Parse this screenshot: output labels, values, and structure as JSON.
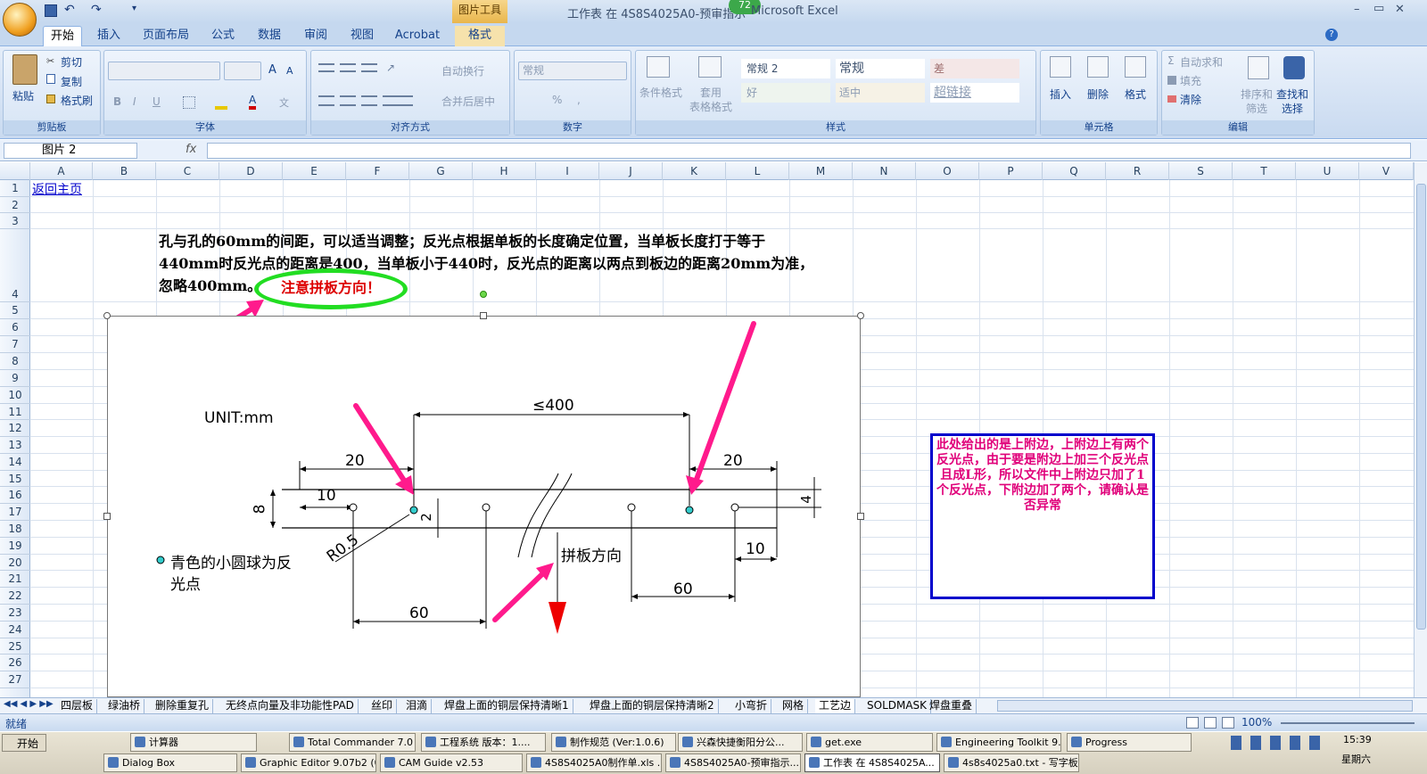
{
  "window": {
    "title": "工作表 在 4S8S4025A0-预审指示",
    "title_suffix": "Microsoft Excel",
    "picture_tools": "图片工具",
    "picture_tools_tab": "格式",
    "badge": "72",
    "min": "–",
    "max": "▭",
    "close": "✕"
  },
  "ribbon_tabs": [
    "开始",
    "插入",
    "页面布局",
    "公式",
    "数据",
    "审阅",
    "视图",
    "Acrobat"
  ],
  "ribbon": {
    "clipboard": {
      "paste": "粘贴",
      "cut": "剪切",
      "copy": "复制",
      "format_painter": "格式刷",
      "label": "剪贴板"
    },
    "font": {
      "label": "字体",
      "grow": "A",
      "shrink": "A",
      "bold": "B",
      "italic": "I",
      "underline": "U",
      "color_letter": "A"
    },
    "alignment": {
      "wrap": "自动换行",
      "merge": "合并后居中",
      "label": "对齐方式"
    },
    "number": {
      "format": "常规",
      "percent": "%",
      "comma": ",",
      "label": "数字"
    },
    "styles": {
      "conditional": "条件格式",
      "table_format_line1": "套用",
      "table_format_line2": "表格格式",
      "normal2": "常规 2",
      "normal": "常规",
      "bad": "差",
      "good": "好",
      "neutral": "适中",
      "hyperlink": "超链接",
      "label": "样式"
    },
    "cells": {
      "insert": "插入",
      "delete": "删除",
      "format": "格式",
      "label": "单元格"
    },
    "editing": {
      "autosum": "自动求和",
      "fill": "填充",
      "clear": "清除",
      "sort_line1": "排序和",
      "sort_line2": "筛选",
      "find_line1": "查找和",
      "find_line2": "选择",
      "label": "编辑"
    }
  },
  "formula_bar": {
    "name_box": "图片 2",
    "fx": "fx",
    "value": ""
  },
  "columns": [
    "A",
    "B",
    "C",
    "D",
    "E",
    "F",
    "G",
    "H",
    "I",
    "J",
    "K",
    "L",
    "M",
    "N",
    "O",
    "P",
    "Q",
    "R",
    "S",
    "T",
    "U",
    "V"
  ],
  "rows": [
    "1",
    "2",
    "3",
    "4",
    "5",
    "6",
    "7",
    "8",
    "9",
    "10",
    "11",
    "12",
    "13",
    "14",
    "15",
    "16",
    "17",
    "18",
    "19",
    "20",
    "21",
    "22",
    "23",
    "24",
    "25",
    "26",
    "27"
  ],
  "cells": {
    "a1_link": "返回主页",
    "note_line1": "孔与孔的60mm的间距，可以适当调整；反光点根据单板的长度确定位置，当单板长度打于等于",
    "note_line2": "440mm时反光点的距离是400，当单板小于440时，反光点的距离以两点到板边的距离20mm为准，",
    "note_line3": "忽略400mm。",
    "callout": "注意拼板方向！",
    "bluebox_text": "此处给出的是上附边，上附边上有两个反光点，由于要是附边上加三个反光点且成L形，所以文件中上附边只加了1个反光点，下附边加了两个，请确认是否异常"
  },
  "drawing": {
    "unit": "UNIT:mm",
    "dim_le400": "≤400",
    "dim_20_left": "20",
    "dim_20_right": "20",
    "dim_10_left": "10",
    "dim_10_right": "10",
    "dim_8": "8",
    "dim_2": "2",
    "dim_4": "4",
    "dim_r05": "R0.5",
    "dim_60_left": "60",
    "dim_60_right": "60",
    "panel_dir": "拼板方向",
    "legend_line1": "青色的小圆球为反",
    "legend_line2": "光点"
  },
  "sheet_tabs": [
    "四层板",
    "绿油桥",
    "删除重复孔",
    "无终点向量及非功能性PAD",
    "丝印",
    "泪滴",
    "焊盘上面的铜层保持清晰1",
    "焊盘上面的铜层保持清晰2",
    "小弯折",
    "网格",
    "工艺边",
    "SOLDMASK",
    "焊盘重叠"
  ],
  "active_sheet": "工艺边",
  "status": {
    "ready": "就绪",
    "zoom": "100%"
  },
  "taskbar_row1": [
    "计算器",
    "Total Commander 7.0 ...",
    "工程系统  版本：1....",
    "制作规范 (Ver:1.0.6)",
    "兴森快捷衡阳分公...",
    "get.exe",
    "Engineering Toolkit 9....",
    "Progress"
  ],
  "taskbar_row2": [
    "Dialog Box",
    "Graphic Editor 9.07b2 (0...",
    "CAM  Guide v2.53",
    "4S8S4025A0制作单.xls ...",
    "4S8S4025A0-预审指示...",
    "工作表 在 4S8S4025A...",
    "4s8s4025a0.txt - 写字板"
  ],
  "start": "开始",
  "clock": {
    "time": "15:39",
    "day": "星期六"
  },
  "colors": {
    "accent": "#15428b",
    "arrow": "#ff1a8c",
    "callout_ring": "#22dd22",
    "callout_text": "#dd0000",
    "cyan_point": "#33cccc",
    "blue_box": "#0000cc"
  }
}
